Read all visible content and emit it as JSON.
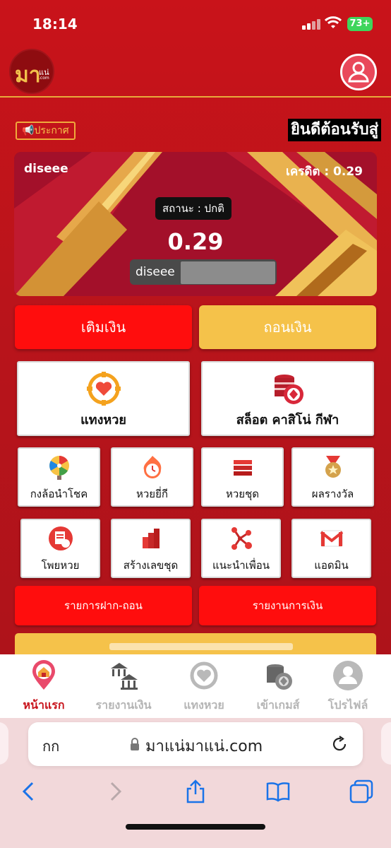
{
  "status_bar": {
    "time": "18:14",
    "battery": "73+"
  },
  "header": {
    "logo": {
      "main": "มา",
      "sub": "แน่",
      "domain": ".com"
    }
  },
  "announce_label": "ประกาศ",
  "welcome_text": "ยินดีต้อนรับสู่",
  "card": {
    "username": "diseee",
    "credit_label": "เครดิต : 0.29",
    "status_label": "สถานะ : ปกติ",
    "amount": "0.29",
    "account_name": "diseee"
  },
  "actions": {
    "deposit": "เติมเงิน",
    "withdraw": "ถอนเงิน"
  },
  "big_tiles": [
    {
      "label": "แทงหวย",
      "icon": "lottery-target-icon"
    },
    {
      "label": "สล็อต คาสิโน่ กีฬา",
      "icon": "casino-chips-icon"
    }
  ],
  "small_tiles": [
    {
      "label": "กงล้อนำโชค",
      "icon": "lucky-wheel-icon"
    },
    {
      "label": "หวยยี่กี",
      "icon": "timer-icon"
    },
    {
      "label": "หวยชุด",
      "icon": "ticket-stack-icon"
    },
    {
      "label": "ผลรางวัล",
      "icon": "medal-icon"
    },
    {
      "label": "โพยหวย",
      "icon": "document-coin-icon"
    },
    {
      "label": "สร้างเลขชุด",
      "icon": "blocks-icon"
    },
    {
      "label": "แนะนำเพื่อน",
      "icon": "network-icon"
    },
    {
      "label": "แอดมิน",
      "icon": "gmail-icon"
    }
  ],
  "reports": {
    "transactions": "รายการฝาก-ถอน",
    "finance": "รายงานการเงิน"
  },
  "bottom_nav": [
    {
      "label": "หน้าแรก",
      "icon": "home-pin-icon",
      "active": true
    },
    {
      "label": "รายงานเงิน",
      "icon": "bank-transfer-icon",
      "active": false
    },
    {
      "label": "แทงหวย",
      "icon": "lottery-target-icon",
      "active": false
    },
    {
      "label": "เข้าเกมส์",
      "icon": "casino-chips-icon",
      "active": false
    },
    {
      "label": "โปรไฟล์",
      "icon": "profile-icon",
      "active": false
    }
  ],
  "browser": {
    "aa": "กก",
    "url": "มาแน่มาแน่.com"
  },
  "colors": {
    "primary_red": "#c9131a",
    "button_red": "#ff0d0d",
    "gold": "#f5c24a",
    "nav_active": "#c8141c"
  }
}
